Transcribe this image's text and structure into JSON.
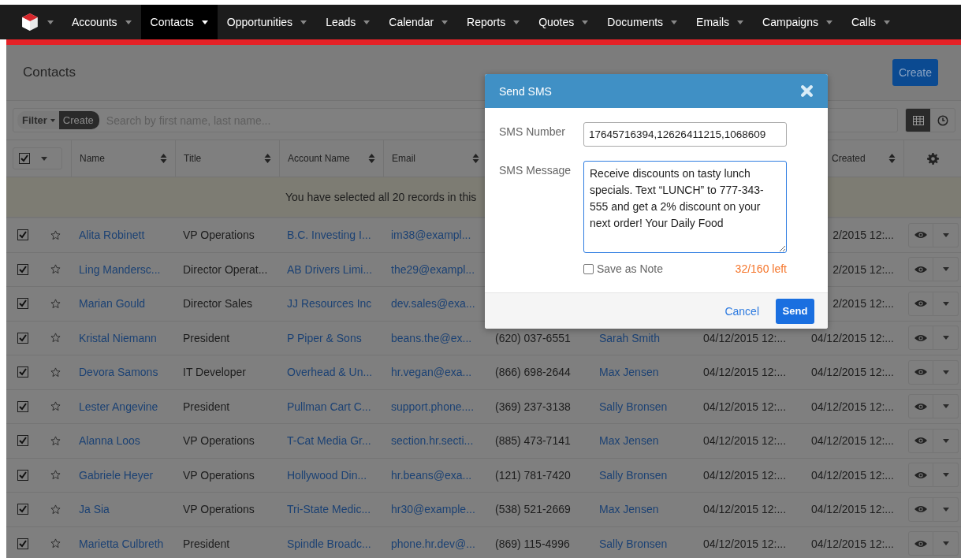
{
  "nav": {
    "items": [
      {
        "label": "Accounts",
        "selected": false
      },
      {
        "label": "Contacts",
        "selected": true
      },
      {
        "label": "Opportunities",
        "selected": false
      },
      {
        "label": "Leads",
        "selected": false
      },
      {
        "label": "Calendar",
        "selected": false
      },
      {
        "label": "Reports",
        "selected": false
      },
      {
        "label": "Quotes",
        "selected": false
      },
      {
        "label": "Documents",
        "selected": false
      },
      {
        "label": "Emails",
        "selected": false
      },
      {
        "label": "Campaigns",
        "selected": false
      },
      {
        "label": "Calls",
        "selected": false
      }
    ]
  },
  "page": {
    "title": "Contacts",
    "create_button": "Create"
  },
  "filter": {
    "filter_label": "Filter",
    "create_label": "Create",
    "placeholder": "Search by first name, last name..."
  },
  "view_toggle": [
    {
      "kind": "grid",
      "selected": true
    },
    {
      "kind": "activity",
      "selected": false
    }
  ],
  "table": {
    "select_all_checked": true,
    "columns": [
      "Name",
      "Title",
      "Account Name",
      "Email"
    ],
    "created_column": "Created",
    "banner": "You have selected all 20 records in this",
    "rows": [
      {
        "checked": true,
        "favorite": false,
        "name": "Alita Robinett",
        "title": "VP Operations",
        "account": "B.C. Investing I...",
        "email": "im38@exampl...",
        "created": "2/2015 12:..."
      },
      {
        "checked": true,
        "favorite": false,
        "name": "Ling Mandersc...",
        "title": "Director Operat...",
        "account": "AB Drivers Limi...",
        "email": "the29@exampl...",
        "created": "2/2015 12:..."
      },
      {
        "checked": true,
        "favorite": false,
        "name": "Marian Gould",
        "title": "Director Sales",
        "account": "JJ Resources Inc",
        "email": "dev.sales@exa...",
        "created": "2/2015 12:..."
      },
      {
        "checked": true,
        "favorite": false,
        "name": "Kristal Niemann",
        "title": "President",
        "account": "P Piper & Sons",
        "email": "beans.the@ex...",
        "phone": "(620) 037-6551",
        "user": "Sarah Smith",
        "modified": "04/12/2015 12:...",
        "created": "04/12/2015 12:..."
      },
      {
        "checked": true,
        "favorite": false,
        "name": "Devora Samons",
        "title": "IT Developer",
        "account": "Overhead & Un...",
        "email": "hr.vegan@exa...",
        "phone": "(866) 698-2644",
        "user": "Max Jensen",
        "modified": "04/12/2015 12:...",
        "created": "04/12/2015 12:..."
      },
      {
        "checked": true,
        "favorite": false,
        "name": "Lester Angevine",
        "title": "President",
        "account": "Pullman Cart C...",
        "email": "support.phone....",
        "phone": "(369) 237-3138",
        "user": "Sally Bronsen",
        "modified": "04/12/2015 12:...",
        "created": "04/12/2015 12:..."
      },
      {
        "checked": true,
        "favorite": false,
        "name": "Alanna Loos",
        "title": "VP Operations",
        "account": "T-Cat Media Gr...",
        "email": "section.hr.secti...",
        "phone": "(885) 473-7141",
        "user": "Max Jensen",
        "modified": "04/12/2015 12:...",
        "created": "04/12/2015 12:..."
      },
      {
        "checked": true,
        "favorite": false,
        "name": "Gabriele Heyer",
        "title": "VP Operations",
        "account": "Hollywood Din...",
        "email": "hr.beans@exa...",
        "phone": "(121) 781-7420",
        "user": "Sally Bronsen",
        "modified": "04/12/2015 12:...",
        "created": "04/12/2015 12:..."
      },
      {
        "checked": true,
        "favorite": false,
        "name": "Ja Sia",
        "title": "VP Operations",
        "account": "Tri-State Medic...",
        "email": "hr30@example...",
        "phone": "(538) 521-2669",
        "user": "Max Jensen",
        "modified": "04/12/2015 12:...",
        "created": "04/12/2015 12:..."
      },
      {
        "checked": true,
        "favorite": false,
        "name": "Marietta Culbreth",
        "title": "President",
        "account": "Spindle Broadc...",
        "email": "phone.hr.dev@...",
        "phone": "(869) 115-4996",
        "user": "Sally Bronsen",
        "modified": "04/12/2015 12:...",
        "created": "04/12/2015 12:..."
      }
    ]
  },
  "modal": {
    "title": "Send SMS",
    "number_label": "SMS Number",
    "number_value": "17645716394,12626411215,1068609",
    "message_label": "SMS Message",
    "message_value": "Receive discounts on tasty lunch specials. Text “LUNCH” to 777-343-555 and get a 2% discount on your next order! Your Daily Food",
    "save_note": {
      "label": "Save as Note",
      "checked": false
    },
    "counter": "32/160 left",
    "cancel": "Cancel",
    "send": "Send"
  }
}
